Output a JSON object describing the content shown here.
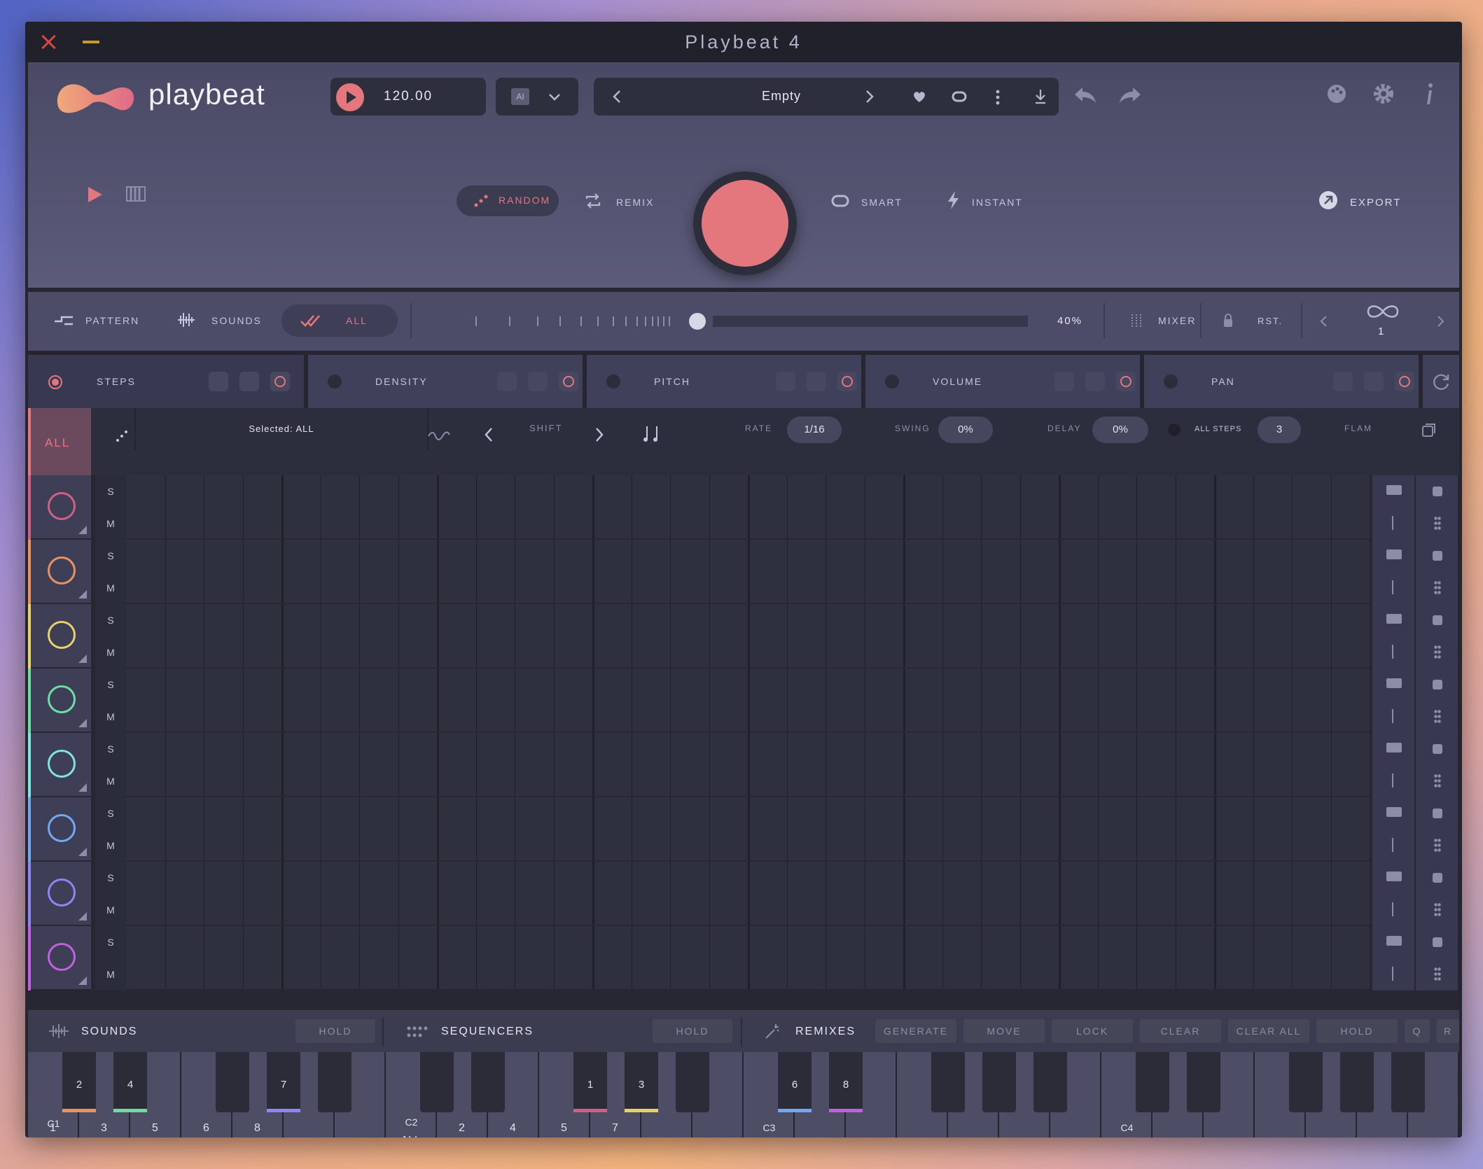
{
  "window": {
    "title": "Playbeat 4"
  },
  "header": {
    "logo_text": "playbeat",
    "tempo": "120.00",
    "ai_badge": "AI",
    "preset_name": "Empty",
    "modes": {
      "random": "RANDOM",
      "remix": "REMIX",
      "smart": "SMART",
      "instant": "INSTANT",
      "export": "EXPORT"
    }
  },
  "controlbar": {
    "pattern": "PATTERN",
    "sounds": "SOUNDS",
    "all": "ALL",
    "amount": "40%",
    "mixer": "MIXER",
    "rst": "RST.",
    "loop_count": "1"
  },
  "features": [
    "STEPS",
    "DENSITY",
    "PITCH",
    "VOLUME",
    "PAN"
  ],
  "toolrow": {
    "all": "ALL",
    "selected": "Selected: ALL",
    "shift": "SHIFT",
    "rate_label": "RATE",
    "rate": "1/16",
    "swing_label": "SWING",
    "swing": "0%",
    "delay_label": "DELAY",
    "delay": "0%",
    "allsteps_label": "ALL STEPS",
    "allsteps": "3",
    "flam": "FLAM"
  },
  "tracks": [
    {
      "icon": "kick-drum-icon",
      "color": "#d05f86",
      "s": "S",
      "m": "M"
    },
    {
      "icon": "snare-icon",
      "color": "#e8935e",
      "s": "S",
      "m": "M"
    },
    {
      "icon": "hihat-icon",
      "color": "#e7d26a",
      "s": "S",
      "m": "M"
    },
    {
      "icon": "cymbal-icon",
      "color": "#6edda4",
      "s": "S",
      "m": "M"
    },
    {
      "icon": "tom-icon",
      "color": "#7fe3e2",
      "s": "S",
      "m": "M"
    },
    {
      "icon": "tambourine-icon",
      "color": "#73a8f0",
      "s": "S",
      "m": "M"
    },
    {
      "icon": "wave-icon",
      "color": "#8e86f1",
      "s": "S",
      "m": "M"
    },
    {
      "icon": "spark-icon",
      "color": "#c35fe0",
      "s": "S",
      "m": "M"
    }
  ],
  "bottombar": {
    "sounds": "SOUNDS",
    "hold1": "HOLD",
    "sequencers": "SEQUENCERS",
    "hold2": "HOLD",
    "remixes": "REMIXES",
    "generate": "GENERATE",
    "move": "MOVE",
    "lock": "LOCK",
    "clear": "CLEAR",
    "clear_all": "CLEAR ALL",
    "hold3": "HOLD",
    "q": "Q",
    "r": "R"
  },
  "keyboard": {
    "c1": "C1",
    "c2": "C2",
    "c3": "C3",
    "c4": "C4",
    "white_labels": [
      "1",
      "3",
      "5",
      "6",
      "8",
      "",
      "",
      "ALL",
      "2",
      "4",
      "5",
      "7"
    ],
    "black_labels": [
      "2",
      "4",
      "7",
      "1",
      "3",
      "6",
      "8"
    ]
  },
  "colors": {
    "accent": "#e4767e",
    "panel": "#4c4c68",
    "grid": "#2f303e"
  }
}
